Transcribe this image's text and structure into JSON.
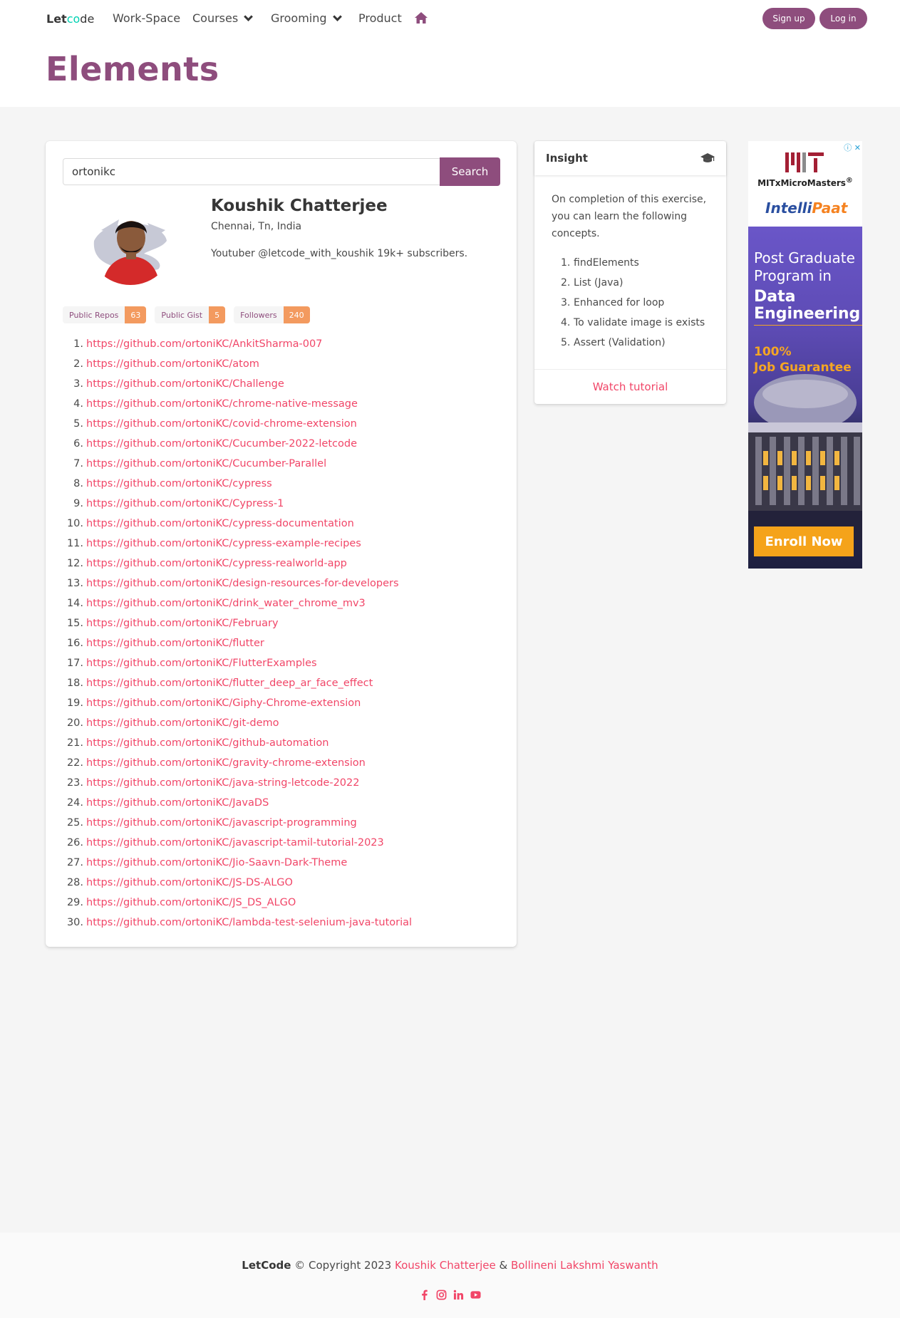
{
  "nav": {
    "brand_prefix": "Let",
    "brand_o": "co",
    "brand_suffix": "de",
    "items": [
      {
        "label": "Work-Space"
      },
      {
        "label": "Courses"
      },
      {
        "label": "Grooming"
      },
      {
        "label": "Product"
      }
    ],
    "home_icon": "home-icon",
    "signup_label": "Sign up",
    "login_label": "Log in"
  },
  "page": {
    "title": "Elements"
  },
  "search": {
    "value": "ortonikc",
    "button_label": "Search"
  },
  "profile": {
    "name": "Koushik Chatterjee",
    "location": "Chennai, Tn, India",
    "bio": "Youtuber @letcode_with_koushik 19k+ subscribers."
  },
  "stats": [
    {
      "label": "Public Repos",
      "value": "63"
    },
    {
      "label": "Public Gist",
      "value": "5"
    },
    {
      "label": "Followers",
      "value": "240"
    }
  ],
  "repos": [
    "https://github.com/ortoniKC/AnkitSharma-007",
    "https://github.com/ortoniKC/atom",
    "https://github.com/ortoniKC/Challenge",
    "https://github.com/ortoniKC/chrome-native-message",
    "https://github.com/ortoniKC/covid-chrome-extension",
    "https://github.com/ortoniKC/Cucumber-2022-letcode",
    "https://github.com/ortoniKC/Cucumber-Parallel",
    "https://github.com/ortoniKC/cypress",
    "https://github.com/ortoniKC/Cypress-1",
    "https://github.com/ortoniKC/cypress-documentation",
    "https://github.com/ortoniKC/cypress-example-recipes",
    "https://github.com/ortoniKC/cypress-realworld-app",
    "https://github.com/ortoniKC/design-resources-for-developers",
    "https://github.com/ortoniKC/drink_water_chrome_mv3",
    "https://github.com/ortoniKC/February",
    "https://github.com/ortoniKC/flutter",
    "https://github.com/ortoniKC/FlutterExamples",
    "https://github.com/ortoniKC/flutter_deep_ar_face_effect",
    "https://github.com/ortoniKC/Giphy-Chrome-extension",
    "https://github.com/ortoniKC/git-demo",
    "https://github.com/ortoniKC/github-automation",
    "https://github.com/ortoniKC/gravity-chrome-extension",
    "https://github.com/ortoniKC/java-string-letcode-2022",
    "https://github.com/ortoniKC/JavaDS",
    "https://github.com/ortoniKC/javascript-programming",
    "https://github.com/ortoniKC/javascript-tamil-tutorial-2023",
    "https://github.com/ortoniKC/Jio-Saavn-Dark-Theme",
    "https://github.com/ortoniKC/JS-DS-ALGO",
    "https://github.com/ortoniKC/JS_DS_ALGO",
    "https://github.com/ortoniKC/lambda-test-selenium-java-tutorial"
  ],
  "insight": {
    "title": "Insight",
    "icon": "graduation-cap-icon",
    "text": "On completion of this exercise, you can learn the following concepts.",
    "concepts": [
      "findElements",
      "List (Java)",
      "Enhanced for loop",
      "To validate image is exists",
      "Assert (Validation)"
    ],
    "footer_link": "Watch tutorial"
  },
  "ad": {
    "mit_text": "MITxMicroMasters",
    "mit_reg": "®",
    "ip_prefix": "I",
    "ip_text": "ntelli",
    "ip_suffix": "Paat",
    "headline": "Post Graduate Program in",
    "headline_bold": "Data Engineering",
    "guarantee_1": "100%",
    "guarantee_2": "Job Guarantee",
    "cta": "Enroll Now"
  },
  "footer": {
    "brand": "LetCode",
    "copyright": "© Copyright 2023",
    "author1": "Koushik Chatterjee",
    "amp": "&",
    "author2": "Bollineni Lakshmi Yaswanth",
    "social_icons": [
      "facebook-icon",
      "instagram-icon",
      "linkedin-icon",
      "youtube-icon"
    ]
  },
  "colors": {
    "brand": "#8e4d7d",
    "link": "#f14668",
    "tag_badge": "#f39a5f",
    "accent": "#00d1b2"
  }
}
